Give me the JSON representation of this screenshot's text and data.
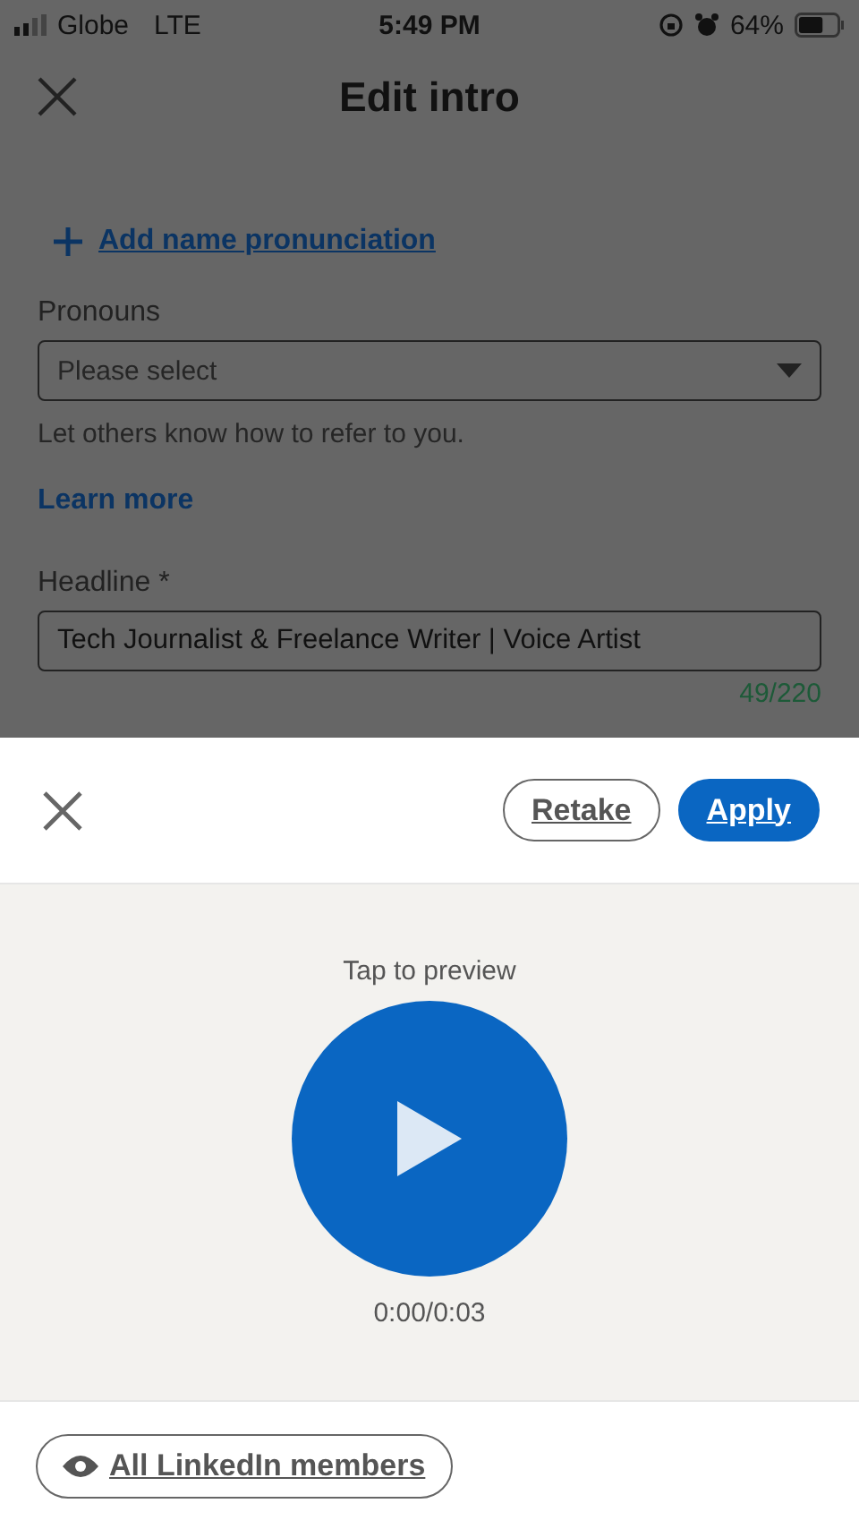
{
  "status_bar": {
    "carrier": "Globe",
    "network": "LTE",
    "time": "5:49 PM",
    "battery": "64%"
  },
  "header": {
    "title": "Edit intro"
  },
  "form": {
    "pronunciation_link": "Add name pronunciation",
    "pronouns": {
      "label": "Pronouns",
      "placeholder": "Please select",
      "hint": "Let others know how to refer to you.",
      "learn_more": "Learn more"
    },
    "headline": {
      "label": "Headline *",
      "value": "Tech Journalist & Freelance Writer | Voice Artist",
      "counter": "49/220"
    }
  },
  "sheet": {
    "buttons": [
      {
        "label": "Retake",
        "kind": "outline"
      },
      {
        "label": "Apply",
        "kind": "primary"
      }
    ],
    "preview_hint": "Tap to preview",
    "duration": "0:00/0:03",
    "visibility": "All LinkedIn members"
  }
}
